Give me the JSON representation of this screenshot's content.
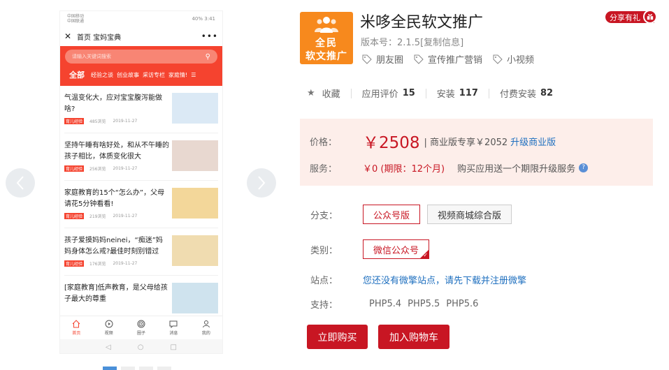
{
  "preview": {
    "status_left_1": "中国移动",
    "status_left_2": "中国联通",
    "status_right": "40%",
    "status_time": "3:41",
    "nav_title": "首页 宝妈宝典",
    "search_placeholder": "请输入关键词搜索",
    "categories": [
      "全部",
      "经验之谈",
      "创业故事",
      "采访专栏",
      "家庭情!"
    ],
    "articles": [
      {
        "title": "气温变化大，应对宝宝腹泻能做啥?",
        "tag": "育儿经验",
        "views": "485浏览",
        "date": "2019-11-27",
        "color": "#dbe9f5"
      },
      {
        "title": "坚持午睡有啥好处，和从不午睡的孩子相比，体质变化很大",
        "tag": "育儿经验",
        "views": "256浏览",
        "date": "2019-11-27",
        "color": "#e8d8d0"
      },
      {
        "title": "家庭教育的15个“怎么办”，父母请花5分钟看看!",
        "tag": "育儿经验",
        "views": "219浏览",
        "date": "2019-11-27",
        "color": "#f3d79a"
      },
      {
        "title": "孩子爱摸妈妈neinei，“痴迷”妈妈身体怎么戒?最佳时刻别错过",
        "tag": "育儿经验",
        "views": "176浏览",
        "date": "2019-11-27",
        "color": "#f0dcb0"
      },
      {
        "title": "[家庭教育]低声教育，是父母给孩子最大的尊重",
        "tag": "",
        "views": "",
        "date": "",
        "color": "#cfe3ee"
      }
    ],
    "tabs": [
      "首页",
      "视频",
      "圈子",
      "消息",
      "我的"
    ]
  },
  "app": {
    "logo_line1": "全民",
    "logo_line2": "软文推广",
    "title": "米哆全民软文推广",
    "version": "版本号：2.1.5[复制信息]",
    "tags": [
      "朋友圈",
      "宣传推广营销",
      "小视频"
    ],
    "share": "分享有礼"
  },
  "stats": {
    "favorite": "收藏",
    "rating_label": "应用评价",
    "rating": "15",
    "install_label": "安装",
    "install": "117",
    "paid_label": "付费安装",
    "paid": "82"
  },
  "pricing": {
    "price_label": "价格：",
    "price": "￥2508",
    "price_extra": "| 商业版专享￥2052",
    "upgrade": "升级商业版",
    "service_label": "服务：",
    "service": "￥0 (期限：12个月)",
    "service_note": "购买应用送一个期限升级服务"
  },
  "options": {
    "branch_label": "分支：",
    "branches": [
      "公众号版",
      "视频商城综合版"
    ],
    "type_label": "类别：",
    "type_value": "微信公众号",
    "site_label": "站点：",
    "site_text": "您还没有微擎站点，请先下载并注册微擎",
    "support_label": "支持：",
    "support": [
      "PHP5.4",
      "PHP5.5",
      "PHP5.6"
    ]
  },
  "actions": {
    "buy": "立即购买",
    "cart": "加入购物车"
  },
  "colors": {
    "brand_red": "#c81623",
    "app_orange": "#f7891d",
    "phone_red": "#f5432f",
    "link_blue": "#1e6fbf"
  }
}
